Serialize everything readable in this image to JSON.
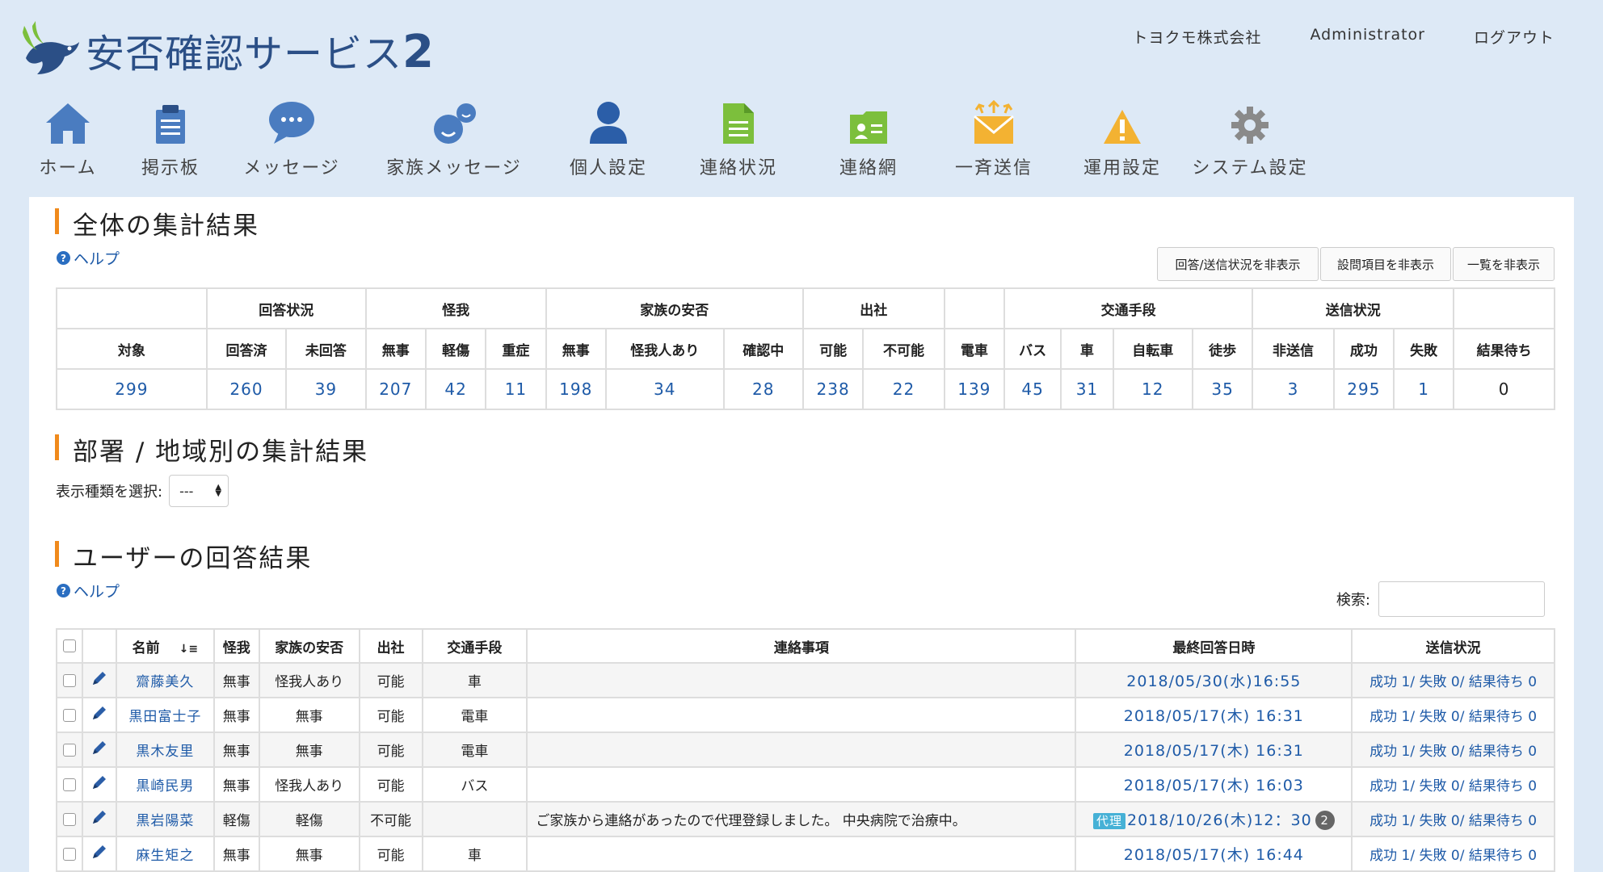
{
  "brand": {
    "title": "安否確認サービス",
    "version": "2"
  },
  "top_links": {
    "company": "トヨクモ株式会社",
    "user": "Administrator",
    "logout": "ログアウト"
  },
  "nav": [
    "ホーム",
    "掲示板",
    "メッセージ",
    "家族メッセージ",
    "個人設定",
    "連絡状況",
    "連絡網",
    "一斉送信",
    "運用設定",
    "システム設定"
  ],
  "colors": {
    "accent": "#f08a1c",
    "link": "#1f5ba8",
    "icon_blue": "#4a7cc0",
    "icon_green": "#7cbf3c",
    "icon_orange": "#f3b232",
    "icon_gray": "#8a8a8a"
  },
  "summary": {
    "title": "全体の集計結果",
    "help": "ヘルプ",
    "buttons": [
      "回答/送信状況を非表示",
      "設問項目を非表示",
      "一覧を非表示"
    ],
    "groups": [
      "回答状況",
      "怪我",
      "家族の安否",
      "出社",
      "交通手段",
      "送信状況"
    ],
    "headers": [
      "対象",
      "回答済",
      "未回答",
      "無事",
      "軽傷",
      "重症",
      "無事",
      "怪我人あり",
      "確認中",
      "可能",
      "不可能",
      "電車",
      "バス",
      "車",
      "自転車",
      "徒歩",
      "非送信",
      "成功",
      "失敗",
      "結果待ち"
    ],
    "values": [
      "299",
      "260",
      "39",
      "207",
      "42",
      "11",
      "198",
      "34",
      "28",
      "238",
      "22",
      "139",
      "45",
      "31",
      "12",
      "35",
      "3",
      "295",
      "1",
      "0"
    ]
  },
  "dept": {
    "title": "部署 / 地域別の集計結果",
    "select_label": "表示種類を選択:",
    "select_value": "---"
  },
  "users": {
    "title": "ユーザーの回答結果",
    "help": "ヘルプ",
    "search_label": "検索:",
    "headers": [
      "名前",
      "怪我",
      "家族の安否",
      "出社",
      "交通手段",
      "連絡事項",
      "最終回答日時",
      "送信状況"
    ],
    "rows": [
      {
        "name": "齋藤美久",
        "injury": "無事",
        "family": "怪我人あり",
        "office": "可能",
        "transport": "車",
        "note": "",
        "date": "2018/05/30(水)16:55",
        "status": "成功 1/ 失敗 0/ 結果待ち 0"
      },
      {
        "name": "黒田富士子",
        "injury": "無事",
        "family": "無事",
        "office": "可能",
        "transport": "電車",
        "note": "",
        "date": "2018/05/17(木) 16:31",
        "status": "成功 1/ 失敗 0/ 結果待ち 0"
      },
      {
        "name": "黒木友里",
        "injury": "無事",
        "family": "無事",
        "office": "可能",
        "transport": "電車",
        "note": "",
        "date": "2018/05/17(木) 16:31",
        "status": "成功 1/ 失敗 0/ 結果待ち 0"
      },
      {
        "name": "黒崎民男",
        "injury": "無事",
        "family": "怪我人あり",
        "office": "可能",
        "transport": "バス",
        "note": "",
        "date": "2018/05/17(木) 16:03",
        "status": "成功 1/ 失敗 0/ 結果待ち 0"
      },
      {
        "name": "黒岩陽菜",
        "injury": "軽傷",
        "family": "軽傷",
        "office": "不可能",
        "transport": "",
        "note": "ご家族から連絡があったので代理登録しました。 中央病院で治療中。",
        "badge": "代理",
        "date": "2018/10/26(木)12：30",
        "count": "2",
        "status": "成功 1/ 失敗 0/ 結果待ち 0"
      },
      {
        "name": "麻生矩之",
        "injury": "無事",
        "family": "無事",
        "office": "可能",
        "transport": "車",
        "note": "",
        "date": "2018/05/17(木) 16:44",
        "status": "成功 1/ 失敗 0/ 結果待ち 0"
      }
    ]
  }
}
